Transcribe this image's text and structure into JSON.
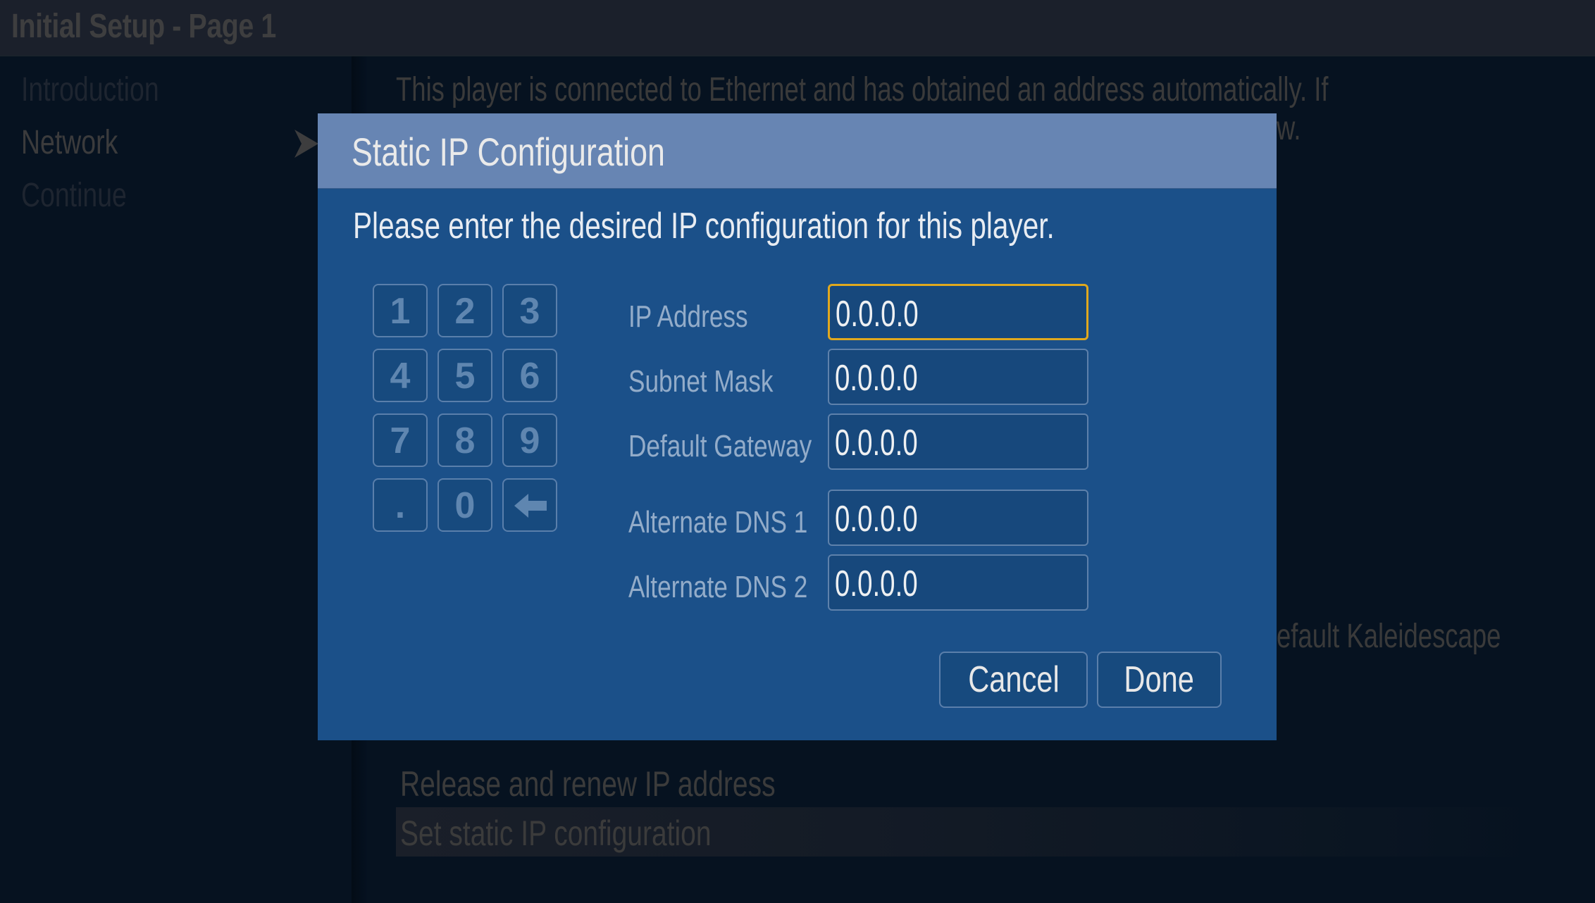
{
  "window": {
    "title": "Initial Setup - Page 1"
  },
  "sidebar": {
    "items": [
      {
        "label": "Introduction",
        "active": false
      },
      {
        "label": "Network",
        "active": true
      },
      {
        "label": "Continue",
        "active": false
      }
    ],
    "active_indicator_icon": "arrow-right-icon"
  },
  "main": {
    "description_line1": "This player is connected to Ethernet and has obtained an address automatically. If",
    "description_line2_end": "w.",
    "partial_text": "efault Kaleidescape",
    "list": [
      {
        "label": "Release and renew IP address",
        "selected": false
      },
      {
        "label": "Set static IP configuration",
        "selected": true
      }
    ]
  },
  "dialog": {
    "title": "Static IP Configuration",
    "prompt": "Please enter the desired IP configuration for this player.",
    "keypad": {
      "keys": [
        "1",
        "2",
        "3",
        "4",
        "5",
        "6",
        "7",
        "8",
        "9",
        ".",
        "0"
      ],
      "backspace_icon": "backspace-arrow-icon"
    },
    "fields": [
      {
        "label": "IP Address",
        "value": "0.0.0.0",
        "focused": true
      },
      {
        "label": "Subnet Mask",
        "value": "0.0.0.0",
        "focused": false
      },
      {
        "label": "Default Gateway",
        "value": "0.0.0.0",
        "focused": false
      },
      {
        "label": "Alternate DNS 1",
        "value": "0.0.0.0",
        "focused": false
      },
      {
        "label": "Alternate DNS 2",
        "value": "0.0.0.0",
        "focused": false
      }
    ],
    "buttons": {
      "cancel": "Cancel",
      "done": "Done"
    }
  },
  "colors": {
    "background": "#061220",
    "header_bar": "#1b202b",
    "dialog_header": "#6785b3",
    "dialog_body": "#1b5089",
    "focus_border": "#e0a81e"
  }
}
